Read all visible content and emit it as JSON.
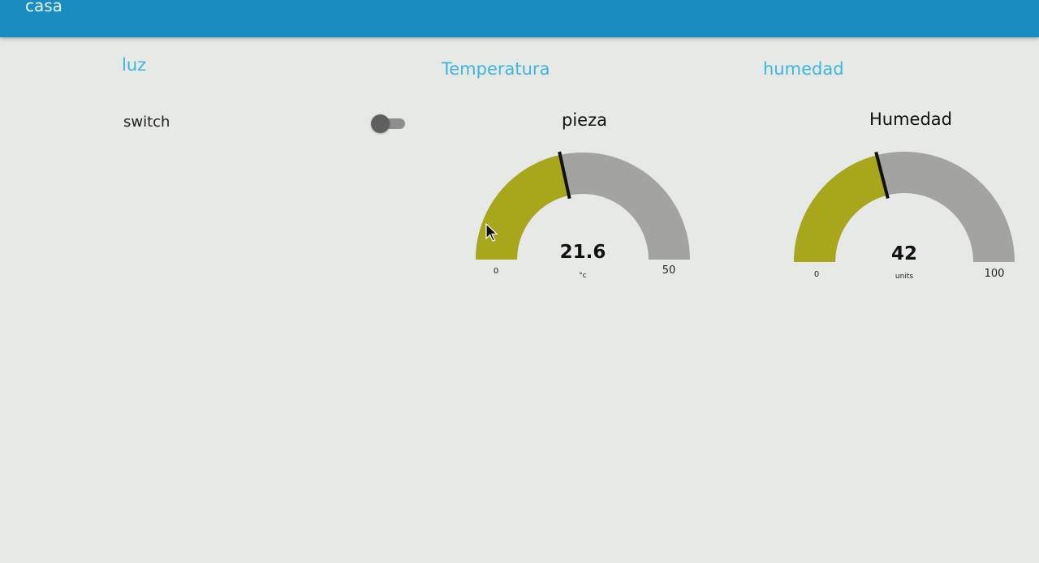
{
  "header": {
    "title": "casa"
  },
  "groups": {
    "luz": {
      "title": "luz"
    },
    "temperatura": {
      "title": "Temperatura"
    },
    "humedad": {
      "title": "humedad"
    }
  },
  "switch_widget": {
    "label": "switch",
    "state": "off"
  },
  "gauges": [
    {
      "title": "pieza",
      "value": 21.6,
      "value_text": "21.6",
      "units": "°c",
      "min": 0,
      "min_text": "0",
      "max": 50,
      "max_text": "50",
      "fill_color": "#a8a61a",
      "track_color": "#a3a3a1",
      "needle_color": "#111111"
    },
    {
      "title": "Humedad",
      "value": 42,
      "value_text": "42",
      "units": "units",
      "min": 0,
      "min_text": "0",
      "max": 100,
      "max_text": "100",
      "fill_color": "#a8a61a",
      "track_color": "#a3a3a1",
      "needle_color": "#111111"
    }
  ],
  "colors": {
    "header_bg": "#1b8cc0",
    "group_title": "#3db6df",
    "page_bg": "#e6e9e5"
  }
}
